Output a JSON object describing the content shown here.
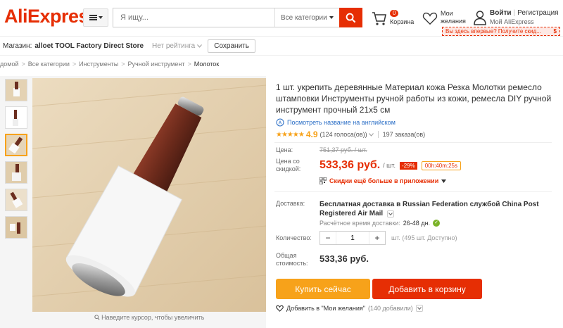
{
  "header": {
    "logo": "AliExpress",
    "search_placeholder": "Я ищу...",
    "category_select": "Все категории",
    "cart_count": "0",
    "cart_label": "Корзина",
    "wishlist_label_1": "Мои",
    "wishlist_label_2": "желания",
    "login": "Войти",
    "register": "Регистрация",
    "my_account": "Мой AliExpress",
    "promo": "Вы здесь впервые? Получите скид...",
    "promo_badge": "$"
  },
  "store": {
    "key": "Магазин:",
    "name": "alloet TOOL Factory Direct Store",
    "rating": "Нет рейтинга",
    "save": "Сохранить"
  },
  "breadcrumb": [
    "домой",
    "Все категории",
    "Инструменты",
    "Ручной инструмент",
    "Молоток"
  ],
  "gallery": {
    "zoom_hint": "Наведите курсор, чтобы увеличить"
  },
  "product": {
    "title": "1 шт. укрепить деревянные Материал кожа Резка Молотки ремесло штамповки Инструменты ручной работы из кожи, ремесла DIY ручной инструмент прочный 21x5 см",
    "translate_link": "Посмотреть название на английском",
    "stars": "★★★★★",
    "rating": "4.9",
    "votes": "(124 голоса(ов))",
    "orders": "197 заказа(ов)"
  },
  "price": {
    "label_price": "Цена:",
    "old_price": "751,37 руб. / шт.",
    "label_discount": "Цена со скидкой:",
    "new_price": "533,36 руб.",
    "per_unit": "/ шт.",
    "discount": "-29%",
    "timer": "00h:40m:25s",
    "app_offer": "Скидки ещё больше в приложении"
  },
  "shipping": {
    "label": "Доставка:",
    "text": "Бесплатная доставка в Russian Federation службой China Post Registered Air Mail",
    "time_label": "Расчётное время доставки:",
    "time_value": "26-48 дн."
  },
  "quantity": {
    "label": "Количество:",
    "value": "1",
    "minus": "−",
    "plus": "+",
    "note": "шт. (495 шт. Доступно)"
  },
  "total": {
    "label": "Общая стоимость:",
    "value": "533,36 руб."
  },
  "actions": {
    "buy": "Купить сейчас",
    "add_cart": "Добавить в корзину",
    "wish_add": "Добавить в \"Мои желания\"",
    "wish_count": "(140 добавили)"
  },
  "colors": {
    "brand": "#e62e04",
    "accent": "#f7a21a"
  }
}
